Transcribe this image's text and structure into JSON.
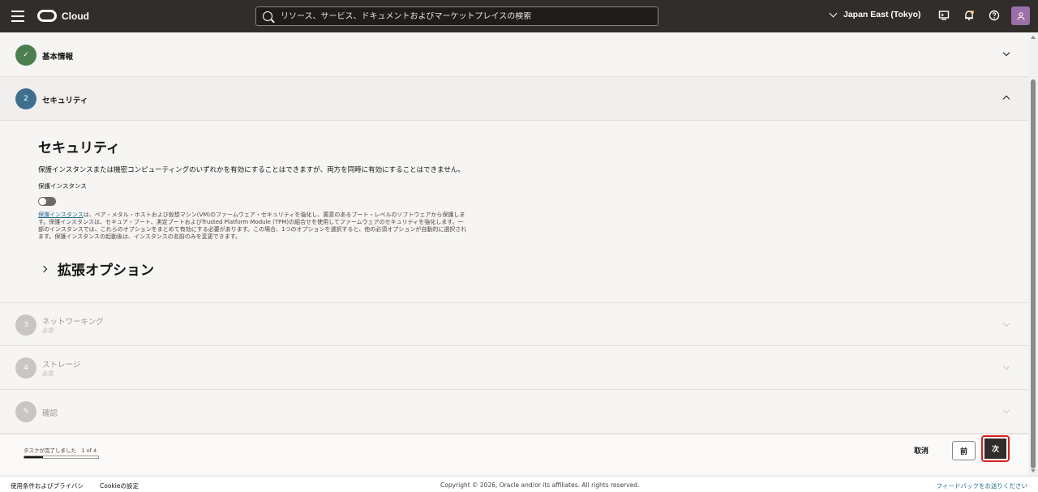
{
  "topbar": {
    "brand": "Cloud",
    "search_placeholder": "リソース、サービス、ドキュメントおよびマーケットプレイスの検索",
    "region": "Japan East (Tokyo)"
  },
  "steps": [
    {
      "number": "✓",
      "title": "基本情報",
      "state": "complete"
    },
    {
      "number": "2",
      "title": "セキュリティ",
      "state": "active"
    },
    {
      "number": "3",
      "title": "ネットワーキング",
      "sub": "必須",
      "state": "disabled"
    },
    {
      "number": "4",
      "title": "ストレージ",
      "sub": "必須",
      "state": "disabled"
    },
    {
      "number": "✎",
      "title": "確認",
      "state": "disabled"
    }
  ],
  "security": {
    "heading": "セキュリティ",
    "description": "保護インスタンスまたは機密コンピューティングのいずれかを有効にすることはできますが、両方を同時に有効にすることはできません。",
    "toggle_label": "保護インスタンス",
    "toggle_on": false,
    "help_link": "保護インスタンス",
    "help_text": "は、ベア・メタル・ホストおよび仮想マシン(VM)のファームウェア・セキュリティを強化し、悪意のあるブート・レベルのソフトウェアから保護します。保護インスタンスは、セキュア・ブート、測定ブートおよびTrusted Platform Module (TPM)の組合せを使用してファームウェアのセキュリティを強化します。一部のインスタンスでは、これらのオプションをまとめて有効にする必要があります。この場合、1つのオプションを選択すると、他の必須オプションが自動的に選択されます。保護インスタンスの起動後は、インスタンスの名前のみを変更できます。",
    "advanced": "拡張オプション"
  },
  "actionbar": {
    "progress_label": "タスクが完了しました　1 of 4",
    "progress_fraction": 0.25,
    "cancel": "取消",
    "prev": "前",
    "next": "次"
  },
  "footer": {
    "terms": "使用条件およびプライバシ",
    "cookie": "Cookieの設定",
    "copyright": "Copyright © 2026, Oracle and/or its affiliates. All rights reserved.",
    "feedback": "フィードバックをお送りください"
  },
  "colors": {
    "topbar": "#312d2a",
    "step_complete": "#4b7f52",
    "step_active": "#3f6f8f",
    "step_disabled": "#c9c6c2",
    "next_highlight": "#d62020"
  }
}
